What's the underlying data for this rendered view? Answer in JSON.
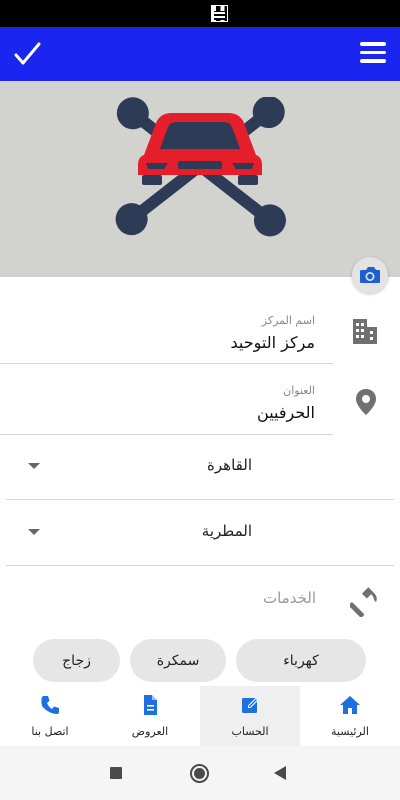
{
  "colors": {
    "app_bar": "#1a26f0",
    "hero_background": "#d2d2cf",
    "icon_primary": "#2d3b57",
    "car_red": "#e41e2b",
    "nav_icon": "#1e6fe0"
  },
  "app_bar": {
    "confirm_icon": "check-icon",
    "menu_icon": "hamburger-menu-icon"
  },
  "hero": {
    "logo_icon": "car-with-crossed-wrenches-logo"
  },
  "form": {
    "center_name": {
      "label": "اسم المركز",
      "value": "مركز التوحيد",
      "icon": "building-icon"
    },
    "address": {
      "label": "العنوان",
      "value": "الحرفيين",
      "icon": "location-pin-icon"
    },
    "city": {
      "selected": "القاهرة"
    },
    "district": {
      "selected": "المطرية"
    },
    "services": {
      "label": "الخدمات",
      "icon": "hammer-icon"
    }
  },
  "chips": [
    "كهرباء",
    "سمكرة",
    "زجاج"
  ],
  "bottom_nav": {
    "items": [
      {
        "label": "الرئيسية",
        "icon": "home-icon"
      },
      {
        "label": "الحساب",
        "icon": "edit-icon"
      },
      {
        "label": "العروض",
        "icon": "document-icon"
      },
      {
        "label": "اتصل بنا",
        "icon": "phone-icon"
      }
    ],
    "active": "الحساب"
  }
}
